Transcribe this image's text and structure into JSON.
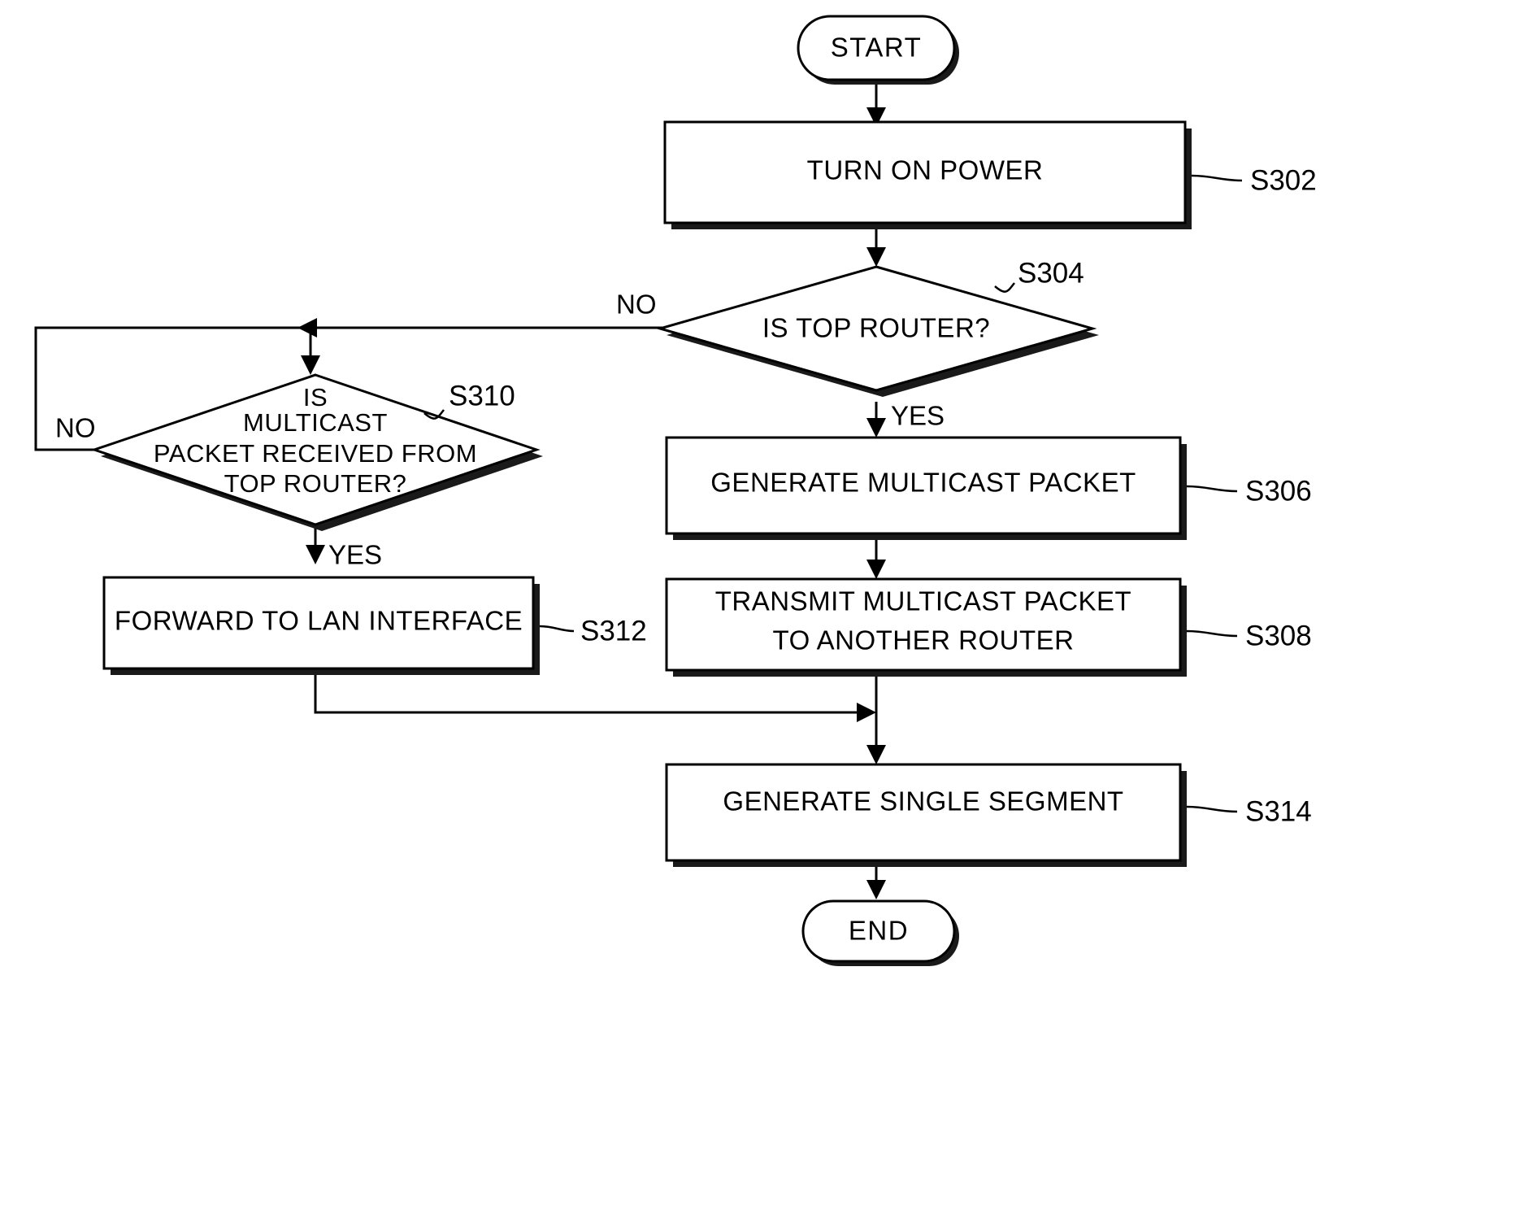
{
  "diagram": {
    "type": "flowchart",
    "title": "",
    "nodes": [
      {
        "id": "start",
        "kind": "terminator",
        "label": "START",
        "ref": ""
      },
      {
        "id": "s302",
        "kind": "process",
        "label": "TURN ON POWER",
        "ref": "S302"
      },
      {
        "id": "s304",
        "kind": "decision",
        "label": "IS TOP ROUTER?",
        "ref": "S304"
      },
      {
        "id": "s306",
        "kind": "process",
        "label": "GENERATE MULTICAST PACKET",
        "ref": "S306"
      },
      {
        "id": "s308",
        "kind": "process",
        "label_line1": "TRANSMIT MULTICAST PACKET",
        "label_line2": "TO ANOTHER ROUTER",
        "ref": "S308"
      },
      {
        "id": "s310",
        "kind": "decision",
        "label_line1": "IS",
        "label_line2": "MULTICAST",
        "label_line3": "PACKET RECEIVED FROM",
        "label_line4": "TOP ROUTER?",
        "ref": "S310"
      },
      {
        "id": "s312",
        "kind": "process",
        "label": "FORWARD TO LAN INTERFACE",
        "ref": "S312"
      },
      {
        "id": "s314",
        "kind": "process",
        "label": "GENERATE SINGLE SEGMENT",
        "ref": "S314"
      },
      {
        "id": "end",
        "kind": "terminator",
        "label": "END",
        "ref": ""
      }
    ],
    "edge_labels": {
      "s304_no": "NO",
      "s304_yes": "YES",
      "s310_no": "NO",
      "s310_yes": "YES"
    },
    "colors": {
      "line": "#000000",
      "fill": "#ffffff",
      "shadow": "#1a1a1a"
    }
  }
}
